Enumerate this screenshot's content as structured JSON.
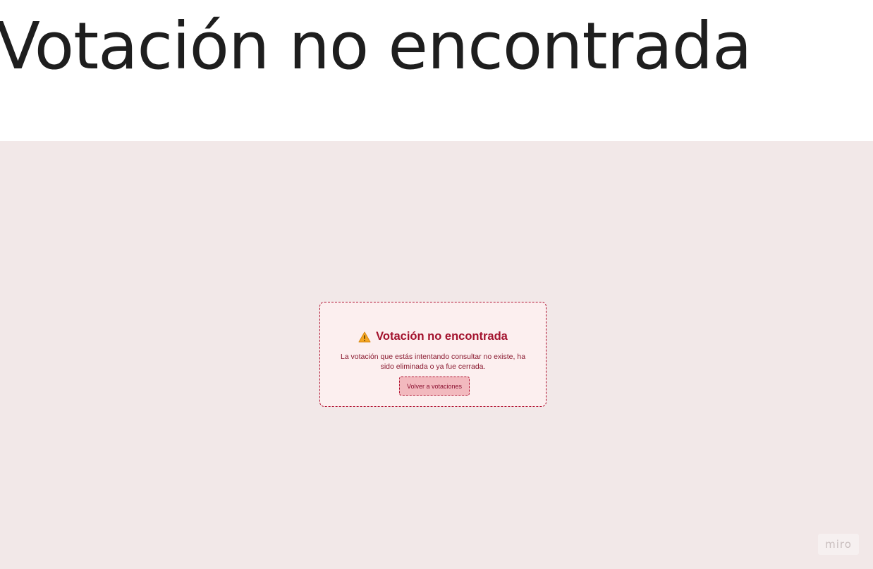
{
  "page": {
    "heading": "Votación no encontrada"
  },
  "error_card": {
    "icon": "warning-icon",
    "title": "Votación no encontrada",
    "message": "La votación que estás intentando consultar no existe, ha sido eliminada o ya fue cerrada.",
    "button_label": "Volver a votaciones"
  },
  "watermark": {
    "label": "miro"
  },
  "colors": {
    "board_background": "#f2e8e8",
    "card_background": "#fcefef",
    "accent": "#a3122d",
    "button_background": "#f2b9be",
    "warning_fill": "#f5a623"
  }
}
